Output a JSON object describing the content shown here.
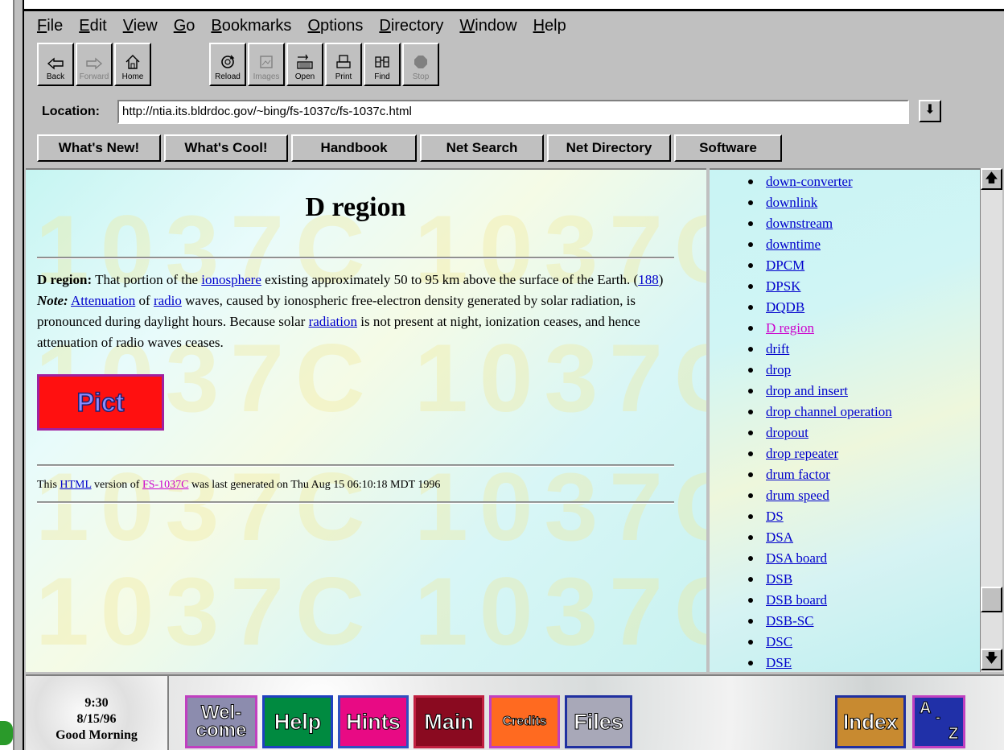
{
  "menu": [
    {
      "u": "F",
      "rest": "ile"
    },
    {
      "u": "E",
      "rest": "dit"
    },
    {
      "u": "V",
      "rest": "iew"
    },
    {
      "u": "G",
      "rest": "o"
    },
    {
      "u": "B",
      "rest": "ookmarks"
    },
    {
      "u": "O",
      "rest": "ptions"
    },
    {
      "u": "D",
      "rest": "irectory"
    },
    {
      "u": "W",
      "rest": "indow"
    },
    {
      "u": "H",
      "rest": "elp"
    }
  ],
  "toolbar": {
    "back": "Back",
    "forward": "Forward",
    "home": "Home",
    "reload": "Reload",
    "images": "Images",
    "open": "Open",
    "print": "Print",
    "find": "Find",
    "stop": "Stop"
  },
  "location": {
    "label": "Location:",
    "url": "http://ntia.its.bldrdoc.gov/~bing/fs-1037c/fs-1037c.html"
  },
  "directory_buttons": [
    "What's New!",
    "What's Cool!",
    "Handbook",
    "Net Search",
    "Net Directory",
    "Software"
  ],
  "watermark": "1037C",
  "page": {
    "title": "D region",
    "term": "D region:",
    "t1": " That portion of the ",
    "link_ionosphere": "ionosphere",
    "t2": " existing approximately 50 to 95 km above the surface of the Earth. (",
    "link_188": "188",
    "t3": ") ",
    "note": "Note:",
    "t4": " ",
    "link_attenuation": "Attenuation",
    "t5": " of ",
    "link_radio": "radio",
    "t6": " waves, caused by ionospheric free-electron density generated by solar radiation, is pronounced during daylight hours. Because solar ",
    "link_radiation": "radiation",
    "t7": " is not present at night, ionization ceases, and hence attenuation of radio waves ceases.",
    "pict_label": "Pict",
    "footer_a": "This ",
    "footer_html": "HTML",
    "footer_b": " version of ",
    "footer_fs": "FS-1037C",
    "footer_c": " was last generated on Thu Aug 15 06:10:18 MDT 1996"
  },
  "sidebar": {
    "current": "D region",
    "items": [
      "down-converter",
      "downlink",
      "downstream",
      "downtime",
      "DPCM",
      "DPSK",
      "DQDB",
      "D region",
      "drift",
      "drop",
      "drop and insert",
      "drop channel operation",
      "dropout",
      "drop repeater",
      "drum factor",
      "drum speed",
      "DS",
      "DSA",
      "DSA board",
      "DSB",
      "DSB board",
      "DSB-SC",
      "DSC",
      "DSE"
    ]
  },
  "clock": {
    "time": "9:30",
    "date": "8/15/96",
    "greeting": "Good Morning"
  },
  "nav_buttons": {
    "welcome_1": "Wel-",
    "welcome_2": "come",
    "help": "Help",
    "hints": "Hints",
    "main": "Main",
    "credits": "Credits",
    "files": "Files",
    "index": "Index",
    "az_a": "A",
    "az_dash": "-",
    "az_z": "Z"
  },
  "colors": {
    "link": "#0000cc",
    "visited": "#cc00cc",
    "chrome": "#c0c0c0",
    "welcome": "#8080a0",
    "help": "#008040",
    "hints": "#e00080",
    "main": "#800020",
    "credits": "#ff6020",
    "files": "#a0a0b0",
    "index": "#c08030",
    "az": "#2030a0"
  }
}
